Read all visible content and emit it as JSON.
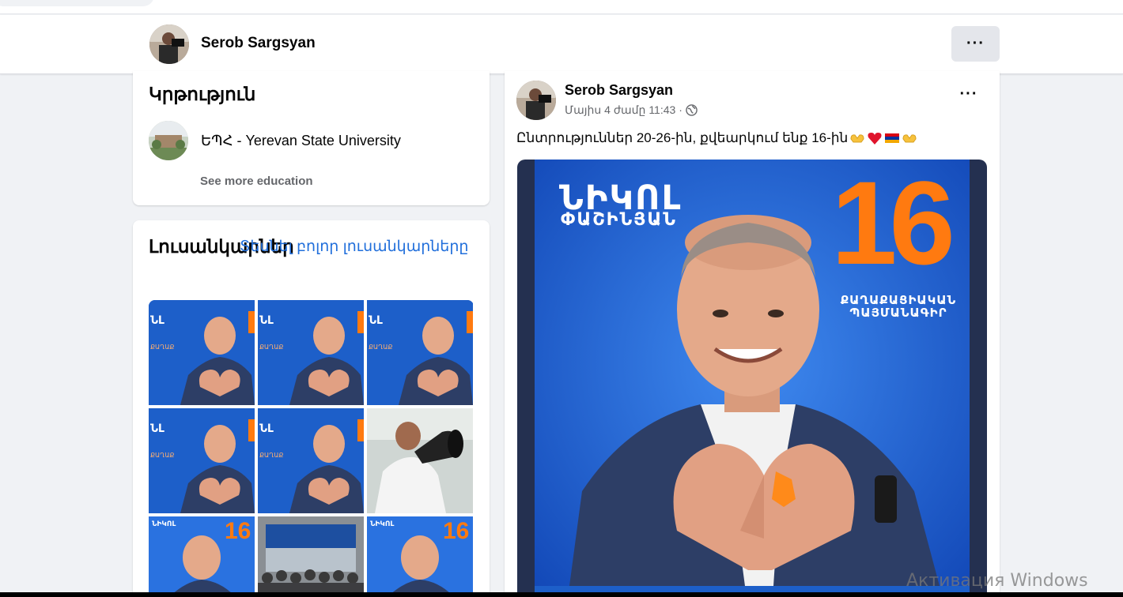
{
  "profile": {
    "name": "Serob Sargsyan",
    "more_label": "···"
  },
  "education": {
    "title": "Կրթություն",
    "school": "ԵՊՀ - Yerevan State University",
    "see_more": "See more education"
  },
  "photos": {
    "title": "Լուսանկարներ",
    "see_all": "Տեսնել բոլոր լուսանկարները",
    "items": [
      {
        "kind": "poster-heart"
      },
      {
        "kind": "poster-heart"
      },
      {
        "kind": "poster-heart"
      },
      {
        "kind": "poster-heart"
      },
      {
        "kind": "poster-heart"
      },
      {
        "kind": "megaphone"
      },
      {
        "kind": "poster-16"
      },
      {
        "kind": "crowd"
      },
      {
        "kind": "poster-16"
      }
    ]
  },
  "post": {
    "author": "Serob Sargsyan",
    "time": "Մայիս 4 ժամը 11:43 ·",
    "dots_label": "···",
    "text": "Ընտրություններ 20-26-ին, քվեարկում ենք 16-ին",
    "emojis": [
      "heart-hands-icon",
      "red-heart-icon",
      "armenia-flag-icon",
      "heart-hands-icon"
    ],
    "poster": {
      "name_line1": "ՆԻԿՈԼ",
      "name_line2": "ՓԱՇԻՆՅԱՆ",
      "number": "16",
      "party_line1": "ՔԱՂԱՔԱՑԻԱԿԱՆ",
      "party_line2": "ՊԱՅՄԱՆԱԳԻՐ"
    }
  },
  "watermark": "Активация Windows",
  "colors": {
    "accent_blue": "#216fdb",
    "poster_blue": "#1d5fc9",
    "poster_orange": "#ff7a10",
    "page_bg": "#f0f2f5"
  }
}
